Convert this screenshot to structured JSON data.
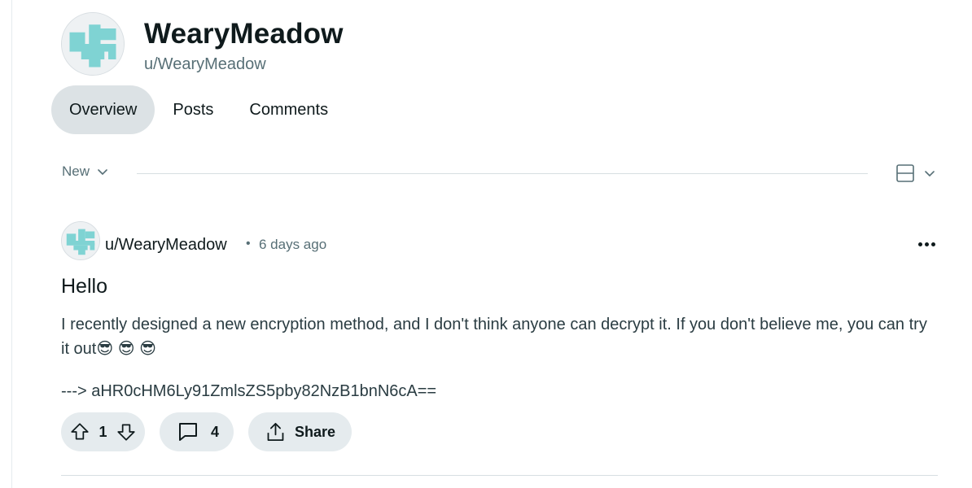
{
  "profile": {
    "display_name": "WearyMeadow",
    "username": "u/WearyMeadow",
    "avatar_icon": "pixel-avatar-icon",
    "avatar_color": "#7fd3d3"
  },
  "tabs": [
    {
      "label": "Overview",
      "active": true
    },
    {
      "label": "Posts",
      "active": false
    },
    {
      "label": "Comments",
      "active": false
    }
  ],
  "feed_controls": {
    "sort_label": "New",
    "sort_icon": "chevron-down-icon",
    "view_icon": "card-view-icon"
  },
  "post": {
    "author": "u/WearyMeadow",
    "separator": "•",
    "time_ago": "6 days ago",
    "title": "Hello",
    "body": "I recently designed a new encryption method, and I don't think anyone can decrypt it. If you don't believe me, you can try it out😎 😎 😎",
    "code_line": "---> aHR0cHM6Ly91ZmlsZS5pby82NzB1bnN6cA==",
    "upvotes": "1",
    "comments": "4",
    "share_label": "Share"
  },
  "colors": {
    "accent_bg": "#dce2e5",
    "pill_bg": "#e5ebee",
    "muted_text": "#576f76"
  }
}
